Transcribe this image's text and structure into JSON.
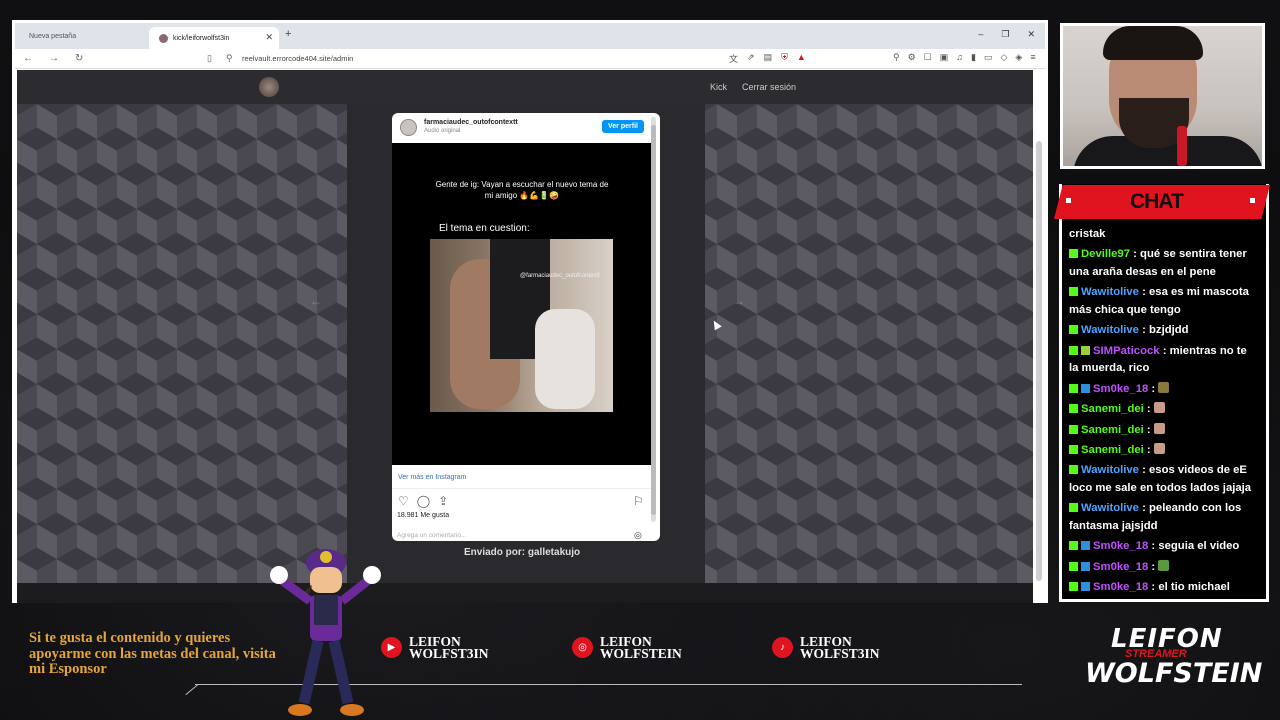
{
  "browser": {
    "tabs": [
      {
        "label": "Nueva pestaña"
      },
      {
        "label": "kick/leiforwolfst3in"
      }
    ],
    "url": "reelvault.errorcode404.site/admin"
  },
  "site": {
    "nav_kick": "Kick",
    "nav_logout": "Cerrar sesión",
    "post": {
      "username": "farmaciaudec_outofcontextt",
      "audio": "Audio original",
      "view_profile": "Ver perfil",
      "caption": "Gente de ig: Vayan a escuchar el nuevo tema de mi amigo 🔥💪🔋🤪",
      "clip_title": "El tema en cuestion:",
      "watermark": "@farmaciaudec_outofcontextt",
      "see_more": "Ver más en Instagram",
      "likes": "18.981 Me gusta",
      "comment_placeholder": "Agrega un comentario..."
    },
    "sender": "Enviado por: galletakujo"
  },
  "chat": {
    "title": "CHAT",
    "messages": [
      {
        "user": "",
        "text": "cristak",
        "user_color": "#ffffff",
        "badges": []
      },
      {
        "user": "Deville97",
        "text": "qué se sentira tener una araña desas en el pene",
        "user_color": "#53fc18",
        "badges": [
          "kick"
        ]
      },
      {
        "user": "Wawitolive",
        "text": "esa es mi mascota más chica que tengo",
        "user_color": "#4da3ff",
        "badges": [
          "kick"
        ]
      },
      {
        "user": "Wawitolive",
        "text": "bzjdjdd",
        "user_color": "#4da3ff",
        "badges": [
          "kick"
        ]
      },
      {
        "user": "SIMPaticock",
        "text": "mientras no te la muerda, rico",
        "user_color": "#c050ff",
        "badges": [
          "kick",
          "plus"
        ]
      },
      {
        "user": "Sm0ke_18",
        "text": "",
        "user_color": "#c050ff",
        "badges": [
          "kick",
          "sub"
        ],
        "emote": "#8a7a3a"
      },
      {
        "user": "Sanemi_dei",
        "text": "",
        "user_color": "#53fc18",
        "badges": [
          "kick"
        ],
        "emote": "#c89a88"
      },
      {
        "user": "Sanemi_dei",
        "text": "",
        "user_color": "#53fc18",
        "badges": [
          "kick"
        ],
        "emote": "#c89a88"
      },
      {
        "user": "Sanemi_dei",
        "text": "",
        "user_color": "#53fc18",
        "badges": [
          "kick"
        ],
        "emote": "#c89a88"
      },
      {
        "user": "Wawitolive",
        "text": "esos videos de eE loco me sale en todos lados jajaja",
        "user_color": "#4da3ff",
        "badges": [
          "kick"
        ]
      },
      {
        "user": "Wawitolive",
        "text": "peleando con los fantasma jajsjdd",
        "user_color": "#4da3ff",
        "badges": [
          "kick"
        ]
      },
      {
        "user": "Sm0ke_18",
        "text": "seguia el video",
        "user_color": "#c050ff",
        "badges": [
          "kick",
          "sub"
        ]
      },
      {
        "user": "Sm0ke_18",
        "text": "",
        "user_color": "#c050ff",
        "badges": [
          "kick",
          "sub"
        ],
        "emote": "#5a9a3a"
      },
      {
        "user": "Sm0ke_18",
        "text": "el tio michael",
        "user_color": "#c050ff",
        "badges": [
          "kick",
          "sub"
        ]
      }
    ]
  },
  "overlay": {
    "promo": "Si te gusta el contenido y quieres apoyarme con las metas del canal, visita mi Esponsor",
    "socials": [
      {
        "icon": "youtube-icon",
        "line1": "LEIFON",
        "line2": "WOLFST3IN"
      },
      {
        "icon": "instagram-icon",
        "line1": "LEIFON",
        "line2": "WOLFSTEIN"
      },
      {
        "icon": "tiktok-icon",
        "line1": "LEIFON",
        "line2": "WOLFST3IN"
      }
    ],
    "logo_top": "LEIFON",
    "logo_bottom": "WOLFSTEIN",
    "logo_red": "STREAMER"
  },
  "colors": {
    "accent": "#e0141e",
    "promo": "#e6a535",
    "kick_green": "#53fc18"
  }
}
